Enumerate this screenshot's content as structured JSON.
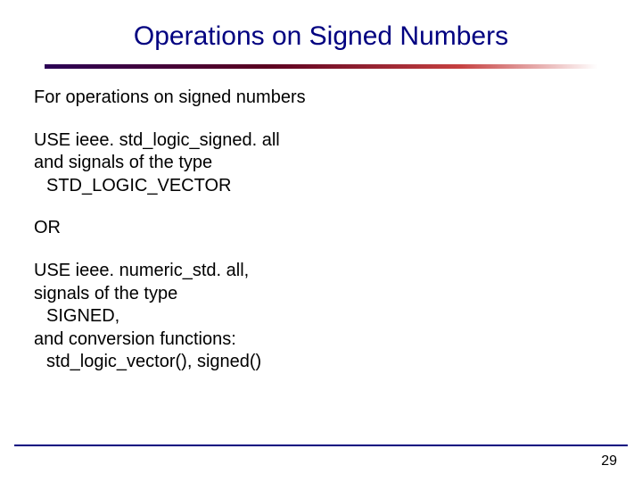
{
  "title": "Operations on Signed Numbers",
  "intro": "For operations on signed numbers",
  "opt1": {
    "l1": "USE ieee. std_logic_signed. all",
    "l2": "and signals of the type",
    "l3": "STD_LOGIC_VECTOR"
  },
  "sep": "OR",
  "opt2": {
    "l1": "USE ieee. numeric_std. all,",
    "l2": "signals of the type",
    "l3": "SIGNED,",
    "l4": "and conversion functions:",
    "l5": "std_logic_vector(), signed()"
  },
  "page": "29"
}
